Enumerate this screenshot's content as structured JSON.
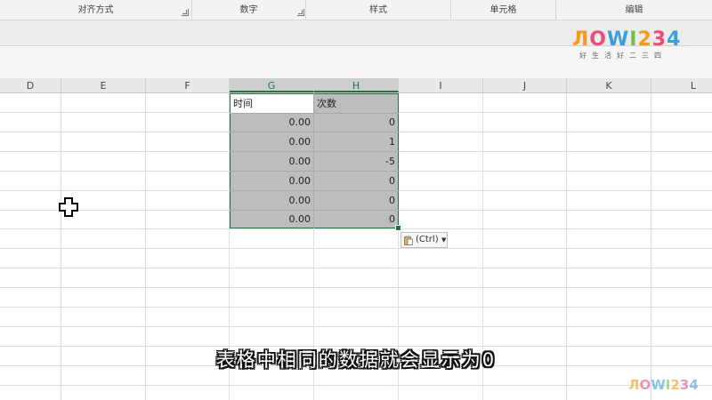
{
  "ribbon": {
    "groups": [
      {
        "label": "对齐方式"
      },
      {
        "label": "数字"
      },
      {
        "label": "样式"
      },
      {
        "label": "单元格"
      },
      {
        "label": "编辑"
      }
    ]
  },
  "logo": {
    "main": "ЛOWI234",
    "sub": "好生活好二三四",
    "colors": [
      "#f29b1d",
      "#e94e77",
      "#3aa0d8",
      "#6cc04a",
      "#f29b1d",
      "#e94e77",
      "#3aa0d8"
    ]
  },
  "columns": [
    "D",
    "E",
    "F",
    "G",
    "H",
    "I",
    "J",
    "K",
    "L"
  ],
  "table": {
    "headers": [
      "时间",
      "次数"
    ],
    "rows": [
      [
        "0.00",
        "0"
      ],
      [
        "0.00",
        "1"
      ],
      [
        "0.00",
        "-5"
      ],
      [
        "0.00",
        "0"
      ],
      [
        "0.00",
        "0"
      ],
      [
        "0.00",
        "0"
      ]
    ]
  },
  "paste_options": {
    "label": "(Ctrl)",
    "icon": "clipboard-icon"
  },
  "cursor": {
    "icon": "cross-cursor-icon"
  },
  "subtitle": "表格中相同的数据就会显示为0",
  "watermark": "ЛOWI234",
  "colors": {
    "selection_border": "#217346",
    "selection_fill": "#bdbdbd"
  }
}
